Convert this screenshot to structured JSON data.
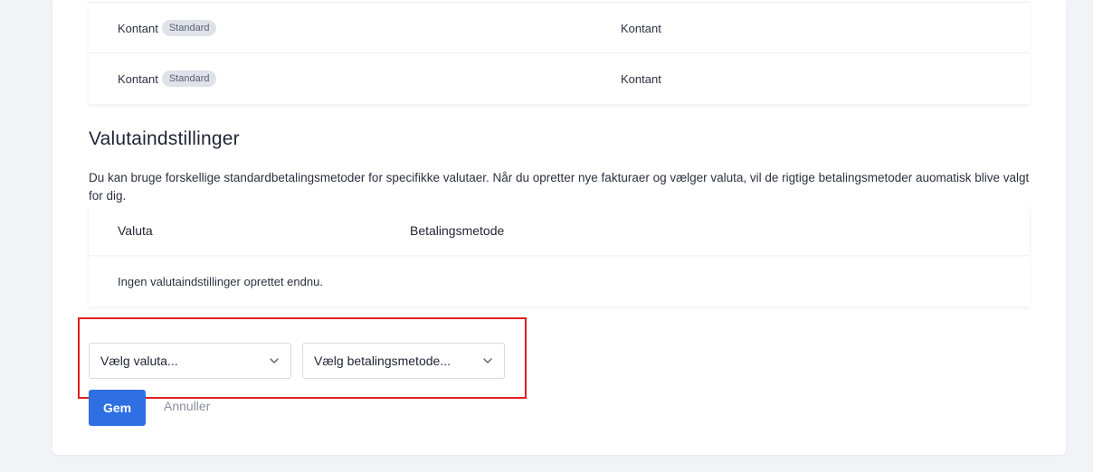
{
  "payment_methods_table": {
    "rows": [
      {
        "name": "Kontant",
        "badge": "Standard",
        "type": "Kontant"
      },
      {
        "name": "Kontant",
        "badge": "Standard",
        "type": "Kontant"
      }
    ]
  },
  "currency_settings": {
    "title": "Valutaindstillinger",
    "description": "Du kan bruge forskellige standardbetalingsmetoder for specifikke valutaer. Når du opretter nye fakturaer og vælger valuta, vil de rigtige betalingsmetoder auomatisk blive valgt for dig.",
    "columns": {
      "currency": "Valuta",
      "payment_method": "Betalingsmetode"
    },
    "empty_text": "Ingen valutaindstillinger oprettet endnu."
  },
  "form": {
    "currency_select": {
      "value": "Vælg valuta..."
    },
    "payment_select": {
      "value": "Vælg betalingsmetode..."
    },
    "save_label": "Gem",
    "cancel_label": "Annuller"
  },
  "colors": {
    "primary": "#2f6fe4",
    "highlight": "#e01e1e",
    "badge_bg": "#dfe2e9"
  }
}
